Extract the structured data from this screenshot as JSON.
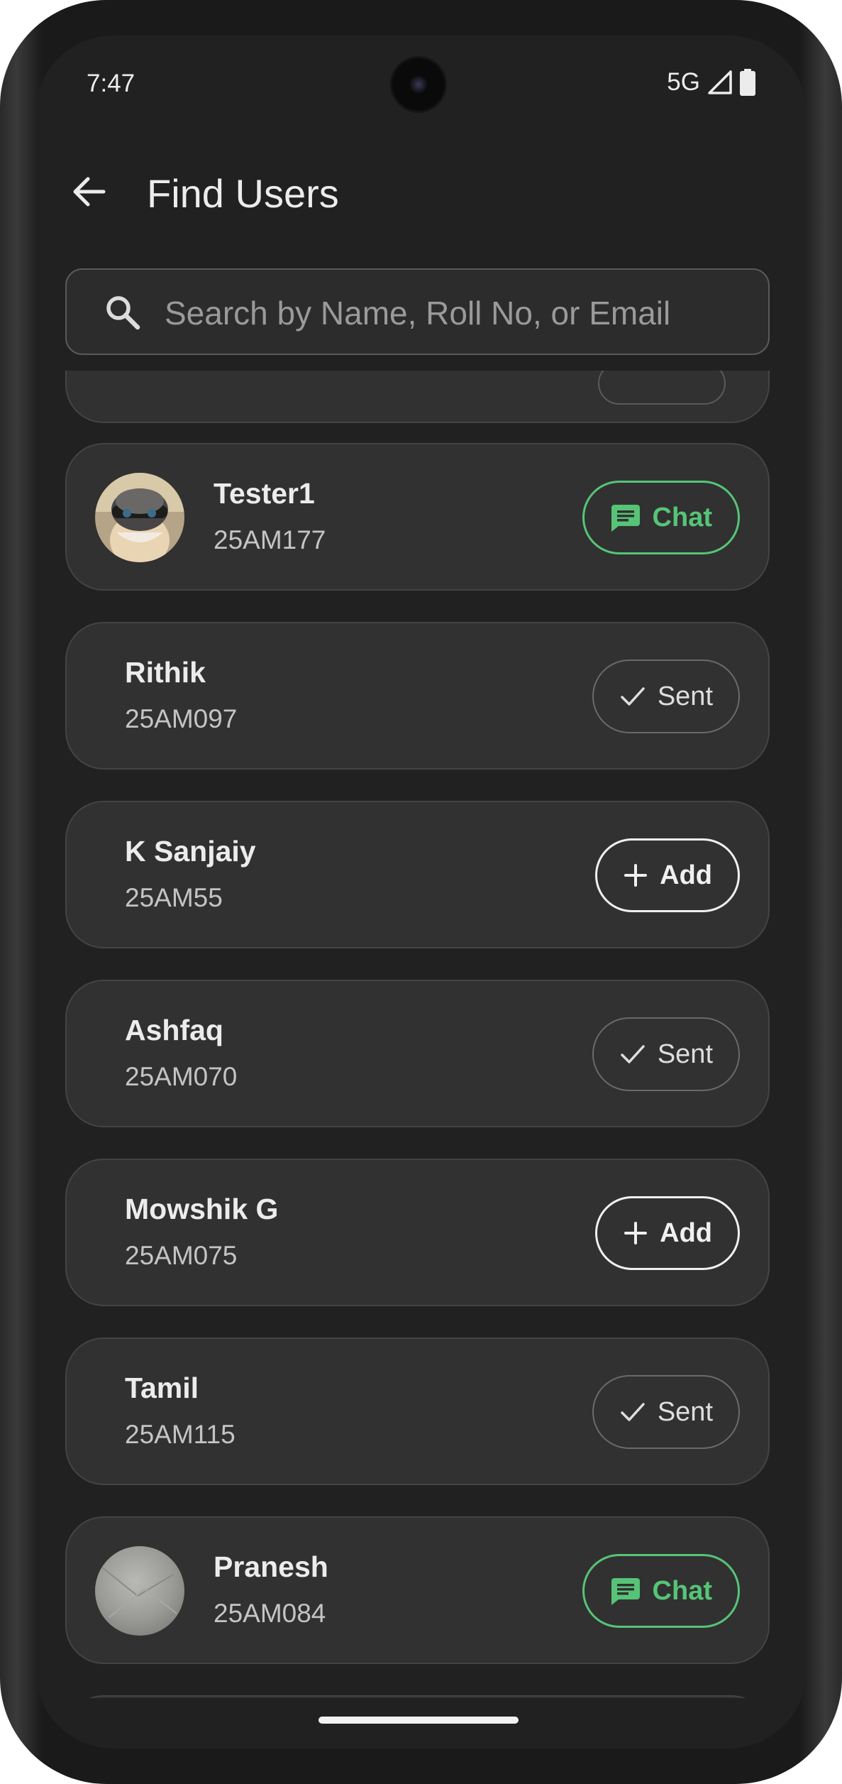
{
  "status_bar": {
    "time": "7:47",
    "network": "5G"
  },
  "top_bar": {
    "title": "Find Users"
  },
  "search": {
    "placeholder": "Search by Name, Roll No, or Email",
    "value": ""
  },
  "users": [
    {
      "name": "Tester1",
      "roll": "25AM177",
      "action": "Chat",
      "avatar": "helmet-cat-photo"
    },
    {
      "name": "Rithik",
      "roll": "25AM097",
      "action": "Sent"
    },
    {
      "name": "K Sanjaiy",
      "roll": "25AM55",
      "action": "Add"
    },
    {
      "name": "Ashfaq",
      "roll": "25AM070",
      "action": "Sent"
    },
    {
      "name": "Mowshik G",
      "roll": "25AM075",
      "action": "Add"
    },
    {
      "name": "Tamil",
      "roll": "25AM115",
      "action": "Sent"
    },
    {
      "name": "Pranesh",
      "roll": "25AM084",
      "action": "Chat",
      "avatar": "gray-texture-photo"
    }
  ],
  "colors": {
    "chat_green": "#56c477",
    "background": "#212121",
    "card": "#313131"
  }
}
